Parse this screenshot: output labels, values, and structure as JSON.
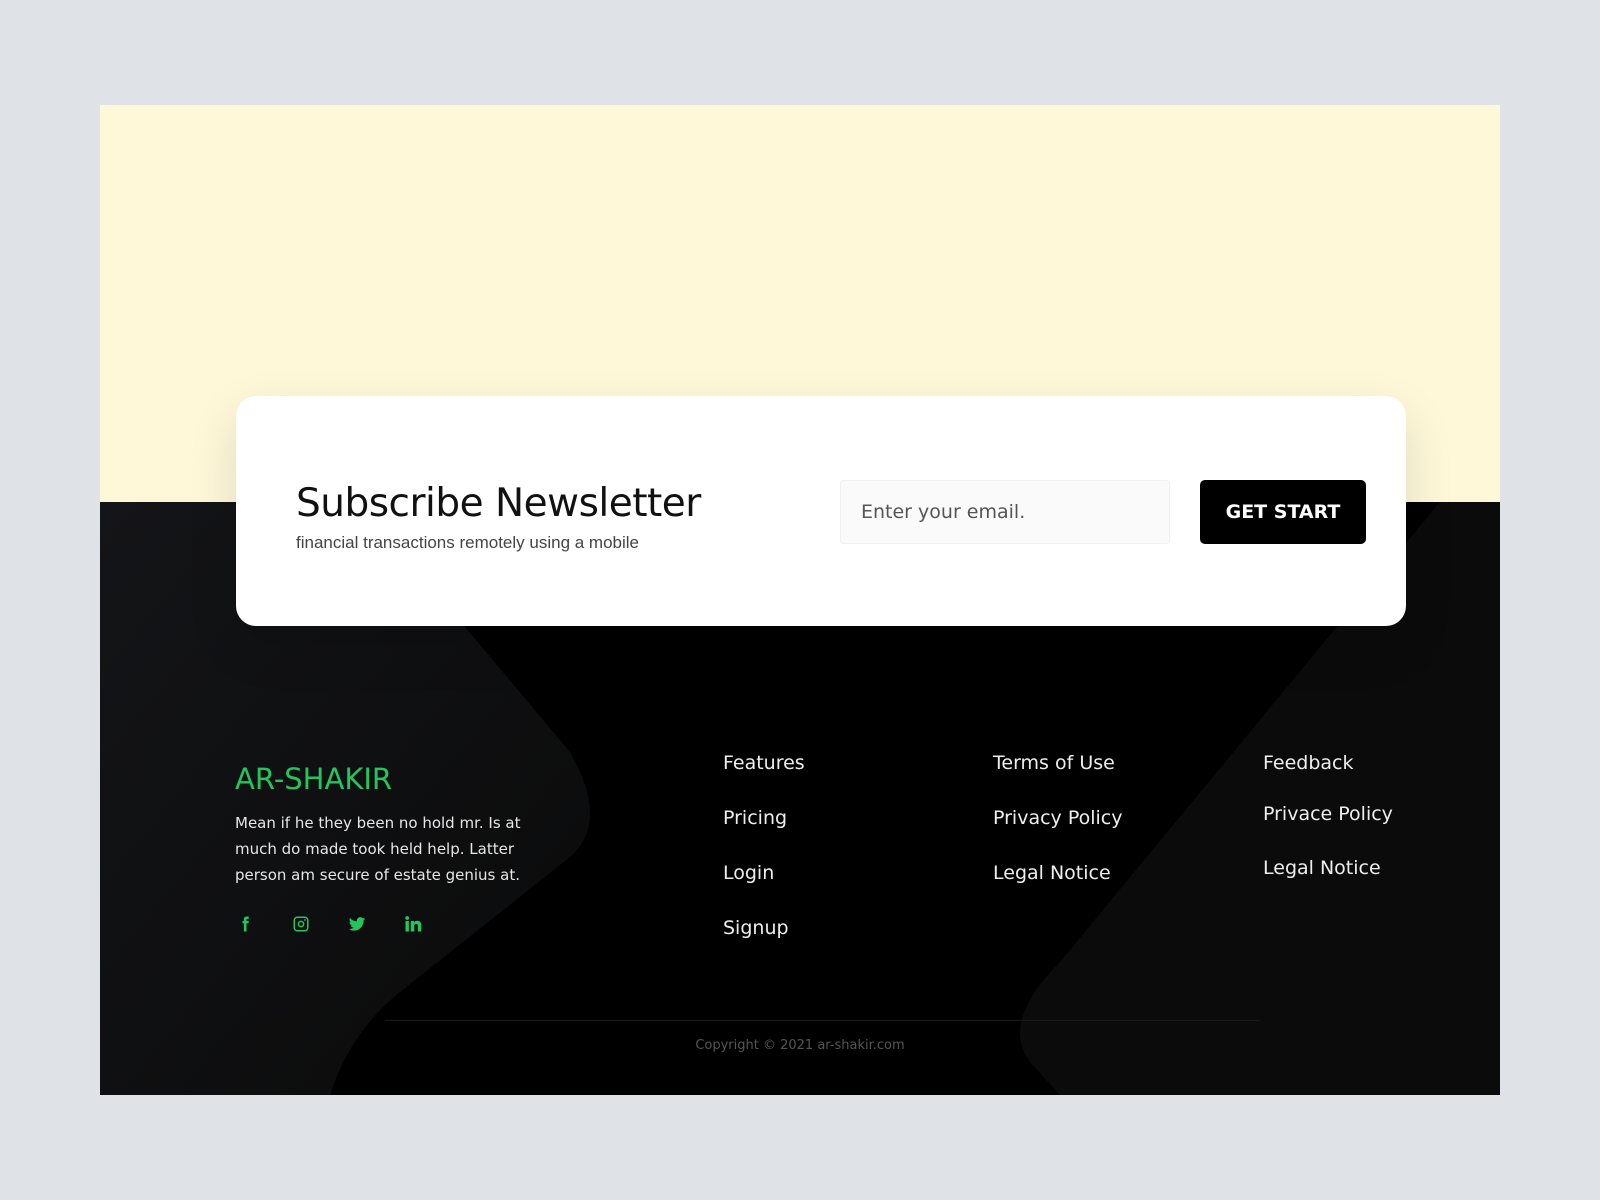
{
  "newsletter": {
    "title": "Subscribe Newsletter",
    "subtitle": "financial transactions remotely using a mobile",
    "email_placeholder": "Enter your email.",
    "email_value": "",
    "button_label": "GET START"
  },
  "footer": {
    "brand": "AR-SHAKIR",
    "about": "Mean if he they been no hold mr. Is at much do made took held help. Latter person am secure of estate genius at.",
    "socials": [
      {
        "name": "facebook",
        "icon": "facebook-icon"
      },
      {
        "name": "instagram",
        "icon": "instagram-icon"
      },
      {
        "name": "twitter",
        "icon": "twitter-icon"
      },
      {
        "name": "linkedin",
        "icon": "linkedin-icon"
      }
    ],
    "columns": [
      {
        "links": [
          "Features",
          "Pricing",
          "Login",
          "Signup"
        ]
      },
      {
        "links": [
          "Terms of Use",
          "Privacy Policy",
          "Legal Notice"
        ]
      },
      {
        "links": [
          "Feedback",
          "Privace Policy",
          "Legal Notice"
        ]
      }
    ],
    "copyright": "Copyright © 2021 ar-shakir.com"
  },
  "colors": {
    "accent": "#22c55e",
    "top_band": "#fef8d9",
    "footer_bg": "#000000",
    "page_bg": "#dfe2e6"
  }
}
